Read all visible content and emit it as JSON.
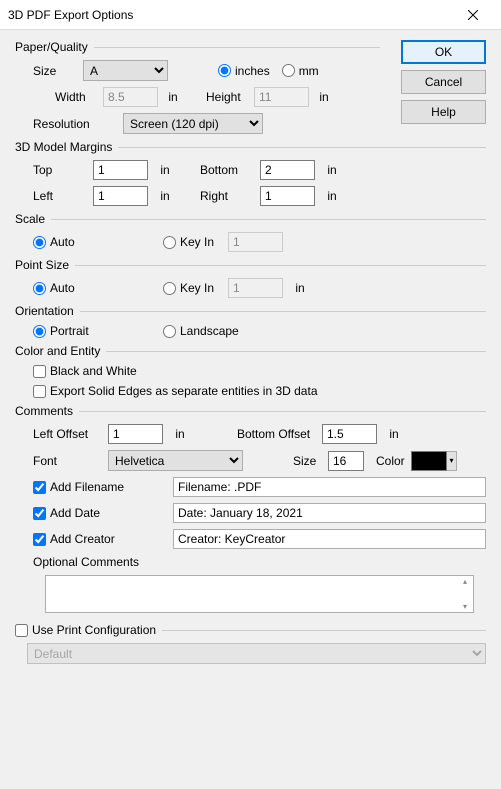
{
  "title": "3D PDF Export Options",
  "buttons": {
    "ok": "OK",
    "cancel": "Cancel",
    "help": "Help"
  },
  "paperQuality": {
    "legend": "Paper/Quality",
    "sizeLabel": "Size",
    "sizeValue": "A",
    "unitsInches": "inches",
    "unitsMm": "mm",
    "widthLabel": "Width",
    "widthValue": "8.5",
    "heightLabel": "Height",
    "heightValue": "11",
    "inUnit": "in",
    "resolutionLabel": "Resolution",
    "resolutionValue": "Screen (120 dpi)"
  },
  "margins": {
    "legend": "3D Model Margins",
    "topLabel": "Top",
    "topValue": "1",
    "bottomLabel": "Bottom",
    "bottomValue": "2",
    "leftLabel": "Left",
    "leftValue": "1",
    "rightLabel": "Right",
    "rightValue": "1",
    "inUnit": "in"
  },
  "scale": {
    "legend": "Scale",
    "auto": "Auto",
    "keyIn": "Key In",
    "keyInValue": "1"
  },
  "pointSize": {
    "legend": "Point Size",
    "auto": "Auto",
    "keyIn": "Key In",
    "keyInValue": "1",
    "inUnit": "in"
  },
  "orientation": {
    "legend": "Orientation",
    "portrait": "Portrait",
    "landscape": "Landscape"
  },
  "colorEntity": {
    "legend": "Color and Entity",
    "bw": "Black and White",
    "solidEdges": "Export Solid Edges as separate entities in 3D data"
  },
  "comments": {
    "legend": "Comments",
    "leftOffsetLabel": "Left Offset",
    "leftOffsetValue": "1",
    "bottomOffsetLabel": "Bottom Offset",
    "bottomOffsetValue": "1.5",
    "inUnit": "in",
    "fontLabel": "Font",
    "fontValue": "Helvetica",
    "sizeLabel": "Size",
    "sizeValue": "16",
    "colorLabel": "Color",
    "addFilename": "Add Filename",
    "filenameBox": "Filename: .PDF",
    "addDate": "Add Date",
    "dateBox": "Date: January 18, 2021",
    "addCreator": "Add Creator",
    "creatorBox": "Creator: KeyCreator",
    "optionalComments": "Optional Comments"
  },
  "printConfig": {
    "label": "Use Print Configuration",
    "value": "Default"
  }
}
